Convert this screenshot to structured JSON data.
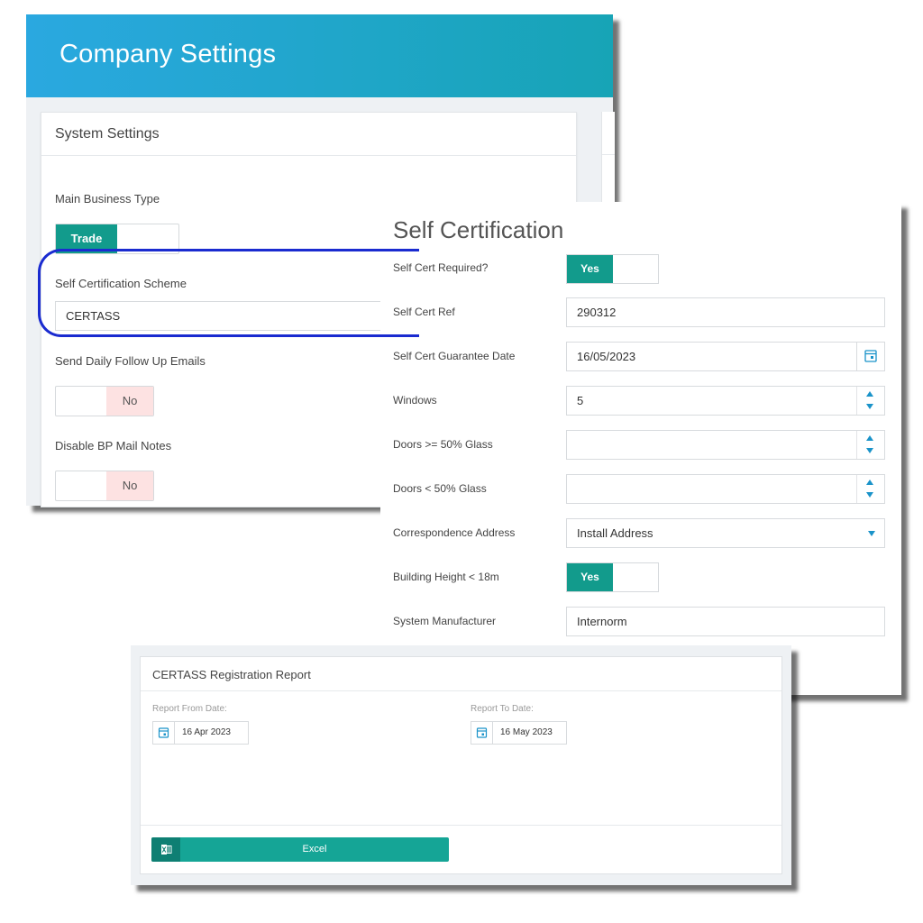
{
  "company": {
    "title": "Company Settings",
    "card_title": "System Settings",
    "main_business_type": {
      "label": "Main Business Type",
      "toggle_on": "Trade"
    },
    "self_cert_scheme": {
      "label": "Self Certification Scheme",
      "value": "CERTASS"
    },
    "daily_follow_up": {
      "label": "Send Daily Follow Up Emails",
      "toggle_off": "No"
    },
    "disable_bp_mail": {
      "label": "Disable BP Mail Notes",
      "toggle_off": "No"
    }
  },
  "self_cert": {
    "title": "Self Certification",
    "required": {
      "label": "Self Cert Required?",
      "toggle_on": "Yes"
    },
    "ref": {
      "label": "Self Cert Ref",
      "value": "290312"
    },
    "guarantee_date": {
      "label": "Self Cert Guarantee Date",
      "value": "16/05/2023"
    },
    "windows": {
      "label": "Windows",
      "value": "5"
    },
    "doors_ge_50": {
      "label": "Doors >= 50% Glass",
      "value": ""
    },
    "doors_lt_50": {
      "label": "Doors < 50% Glass",
      "value": ""
    },
    "correspondence": {
      "label": "Correspondence Address",
      "value": "Install Address"
    },
    "building_height": {
      "label": "Building Height < 18m",
      "toggle_on": "Yes"
    },
    "system_manufacturer": {
      "label": "System Manufacturer",
      "value": "Internorm"
    }
  },
  "report": {
    "title": "CERTASS Registration Report",
    "from": {
      "label": "Report From Date:",
      "value": "16 Apr 2023"
    },
    "to": {
      "label": "Report To Date:",
      "value": "16 May 2023"
    },
    "excel_label": "Excel"
  },
  "colors": {
    "header_start": "#2aa8e0",
    "header_end": "#17a4b6",
    "toggle_on": "#129b8c",
    "toggle_off_bg": "#fde2e2",
    "highlight": "#1a2bd0",
    "excel": "#15a596"
  }
}
